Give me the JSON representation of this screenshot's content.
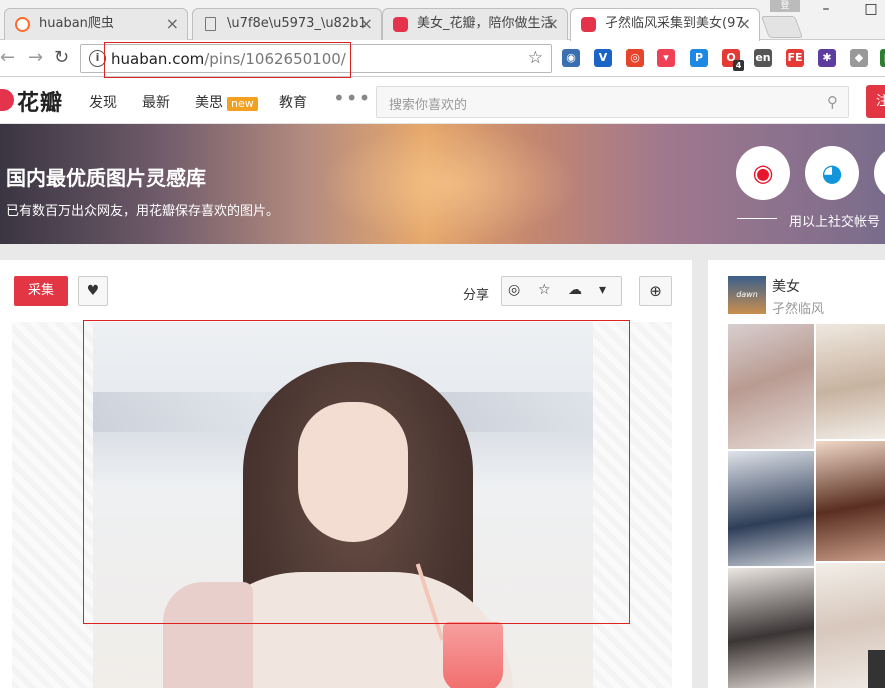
{
  "browser": {
    "tabs": [
      {
        "title": "huaban爬虫",
        "favicon_color": "#ff6a2b"
      },
      {
        "title": "\\u7f8e\\u5973_\\u82b1",
        "favicon_color": "#ffffff"
      },
      {
        "title": "美女_花瓣，陪你做生活",
        "favicon_color": "#e5334b"
      },
      {
        "title": "孑然临风采集到美女(97",
        "favicon_color": "#e5334b"
      }
    ],
    "profile_label": "登",
    "window_buttons": {
      "minimize": "–",
      "maximize": "□"
    },
    "url_host": "huaban.com",
    "url_path": "/pins/1062650100/",
    "star_icon": "☆",
    "info_icon": "i",
    "back_icon": "←",
    "forward_icon": "→",
    "reload_icon": "↻",
    "extensions": [
      {
        "name": "globe-ext",
        "label": "◉",
        "color": "#3a6fb0"
      },
      {
        "name": "v-ext",
        "label": "V",
        "color": "#1c63c6"
      },
      {
        "name": "weibo-ext",
        "label": "◎",
        "color": "#e6442b"
      },
      {
        "name": "pocket-ext",
        "label": "▾",
        "color": "#ef4056"
      },
      {
        "name": "p-ext",
        "label": "P",
        "color": "#1e88e5"
      },
      {
        "name": "red-o-ext",
        "label": "O",
        "color": "#e53935"
      },
      {
        "name": "en-ext",
        "label": "en",
        "color": "#555555"
      },
      {
        "name": "fe-ext",
        "label": "FE",
        "color": "#e53935"
      },
      {
        "name": "purple-ext",
        "label": "✱",
        "color": "#5c3c9e"
      },
      {
        "name": "grey-ext",
        "label": "◆",
        "color": "#999999"
      },
      {
        "name": "green-ext",
        "label": "▤",
        "color": "#2e7d32"
      }
    ],
    "ext_badge": "4"
  },
  "header": {
    "logo_text": "花瓣",
    "nav": [
      {
        "label": "发现"
      },
      {
        "label": "最新"
      },
      {
        "label": "美思",
        "badge": "new"
      },
      {
        "label": "教育"
      }
    ],
    "more_label": "•••",
    "search_placeholder": "搜索你喜欢的",
    "search_icon": "⚲",
    "right_button_label": "注"
  },
  "banner": {
    "title": "国内最优质图片灵感库",
    "subtitle": "已有数百万出众网友，用花瓣保存喜欢的图片。",
    "social": [
      {
        "name": "weibo",
        "glyph": "◉",
        "color": "#e6162d"
      },
      {
        "name": "qq",
        "glyph": "◕",
        "color": "#1296db"
      }
    ],
    "social_text": "用以上社交帐号"
  },
  "pin": {
    "collect_label": "采集",
    "like_icon": "♥",
    "share_label": "分享",
    "share_icons": [
      "◎",
      "☆",
      "☁",
      "▾"
    ],
    "zoom_icon": "⊕"
  },
  "side": {
    "board_thumb_text": "dawn",
    "board_title": "美女",
    "board_user": "孑然临风"
  },
  "colors": {
    "brand_red": "#e23645",
    "annotation_red": "#dd2222"
  }
}
